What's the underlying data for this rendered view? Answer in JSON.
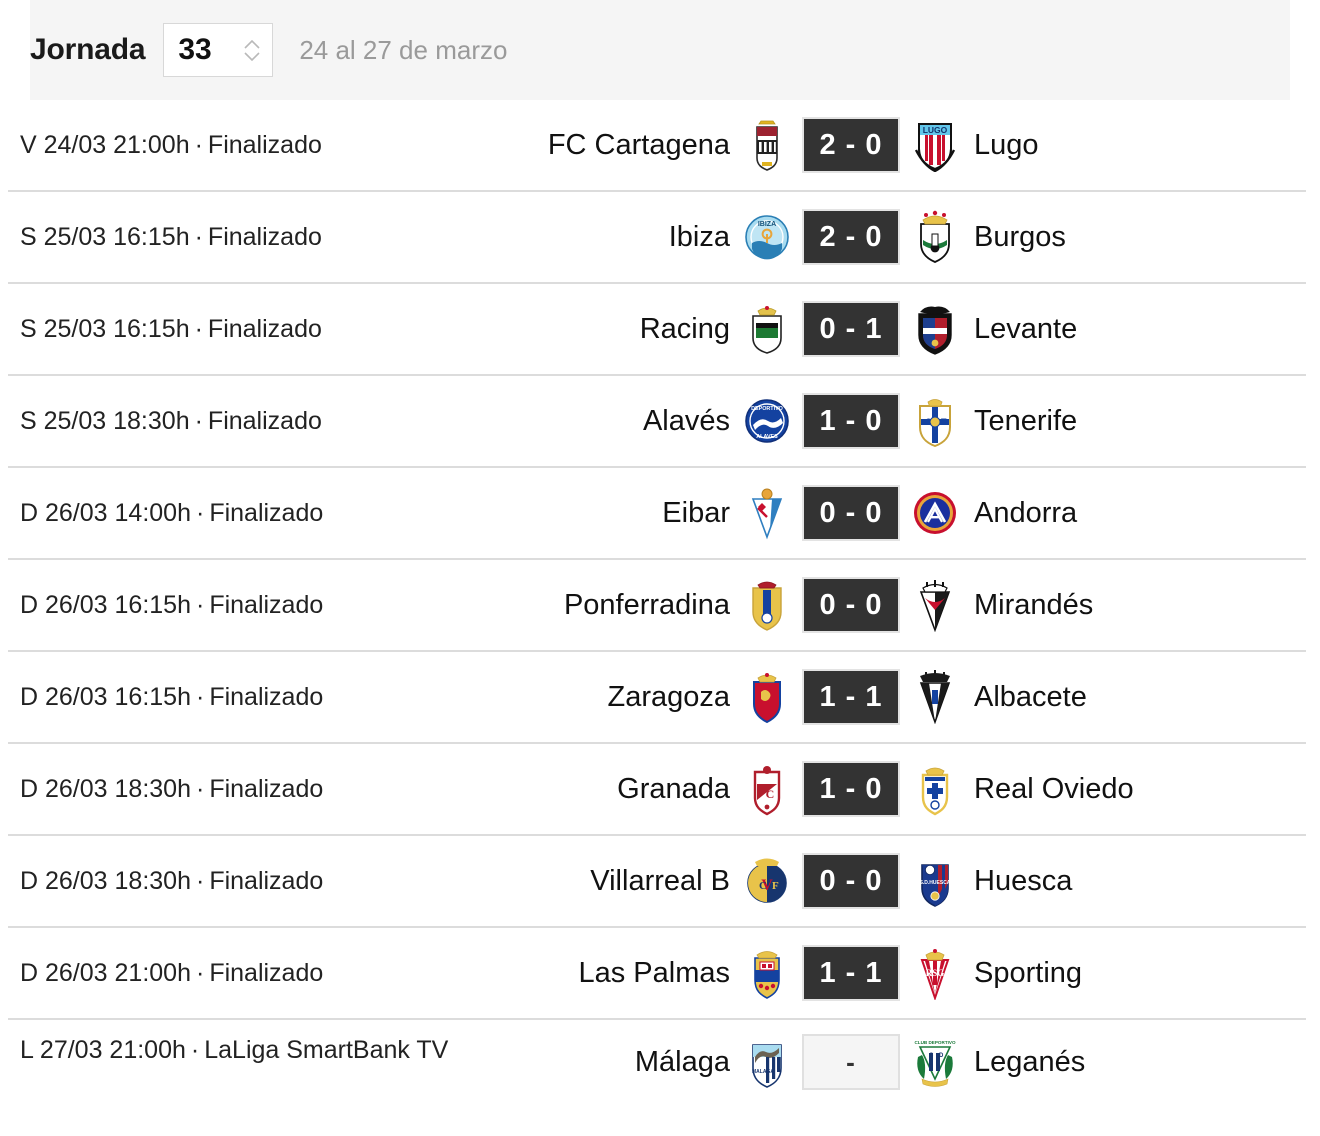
{
  "header": {
    "title": "Jornada",
    "matchday": "33",
    "date_range": "24 al 27 de marzo",
    "stepper_up_icon": "chevron-up-icon",
    "stepper_down_icon": "chevron-down-icon"
  },
  "separator": "·",
  "matches": [
    {
      "datetime": "V 24/03 21:00h",
      "status": "Finalizado",
      "home": "FC Cartagena",
      "away": "Lugo",
      "home_crest": "fc-cartagena-crest",
      "away_crest": "lugo-crest",
      "score": "2 - 0",
      "played": true
    },
    {
      "datetime": "S 25/03 16:15h",
      "status": "Finalizado",
      "home": "Ibiza",
      "away": "Burgos",
      "home_crest": "ibiza-crest",
      "away_crest": "burgos-crest",
      "score": "2 - 0",
      "played": true
    },
    {
      "datetime": "S 25/03 16:15h",
      "status": "Finalizado",
      "home": "Racing",
      "away": "Levante",
      "home_crest": "racing-santander-crest",
      "away_crest": "levante-crest",
      "score": "0 - 1",
      "played": true
    },
    {
      "datetime": "S 25/03 18:30h",
      "status": "Finalizado",
      "home": "Alavés",
      "away": "Tenerife",
      "home_crest": "alaves-crest",
      "away_crest": "tenerife-crest",
      "score": "1 - 0",
      "played": true
    },
    {
      "datetime": "D 26/03 14:00h",
      "status": "Finalizado",
      "home": "Eibar",
      "away": "Andorra",
      "home_crest": "eibar-crest",
      "away_crest": "andorra-crest",
      "score": "0 - 0",
      "played": true
    },
    {
      "datetime": "D 26/03 16:15h",
      "status": "Finalizado",
      "home": "Ponferradina",
      "away": "Mirandés",
      "home_crest": "ponferradina-crest",
      "away_crest": "mirandes-crest",
      "score": "0 - 0",
      "played": true
    },
    {
      "datetime": "D 26/03 16:15h",
      "status": "Finalizado",
      "home": "Zaragoza",
      "away": "Albacete",
      "home_crest": "zaragoza-crest",
      "away_crest": "albacete-crest",
      "score": "1 - 1",
      "played": true
    },
    {
      "datetime": "D 26/03 18:30h",
      "status": "Finalizado",
      "home": "Granada",
      "away": "Real Oviedo",
      "home_crest": "granada-crest",
      "away_crest": "real-oviedo-crest",
      "score": "1 - 0",
      "played": true
    },
    {
      "datetime": "D 26/03 18:30h",
      "status": "Finalizado",
      "home": "Villarreal B",
      "away": "Huesca",
      "home_crest": "villarreal-b-crest",
      "away_crest": "huesca-crest",
      "score": "0 - 0",
      "played": true
    },
    {
      "datetime": "D 26/03 21:00h",
      "status": "Finalizado",
      "home": "Las Palmas",
      "away": "Sporting",
      "home_crest": "las-palmas-crest",
      "away_crest": "sporting-gijon-crest",
      "score": "1 - 1",
      "played": true
    },
    {
      "datetime": "L 27/03 21:00h",
      "status": "LaLiga SmartBank TV",
      "home": "Málaga",
      "away": "Leganés",
      "home_crest": "malaga-crest",
      "away_crest": "leganes-crest",
      "score": "-",
      "played": false
    }
  ],
  "colors": {
    "header_bg": "#f5f5f5",
    "score_bg": "#333333",
    "divider": "#dcdcdc",
    "muted_text": "#9a9a9a"
  }
}
